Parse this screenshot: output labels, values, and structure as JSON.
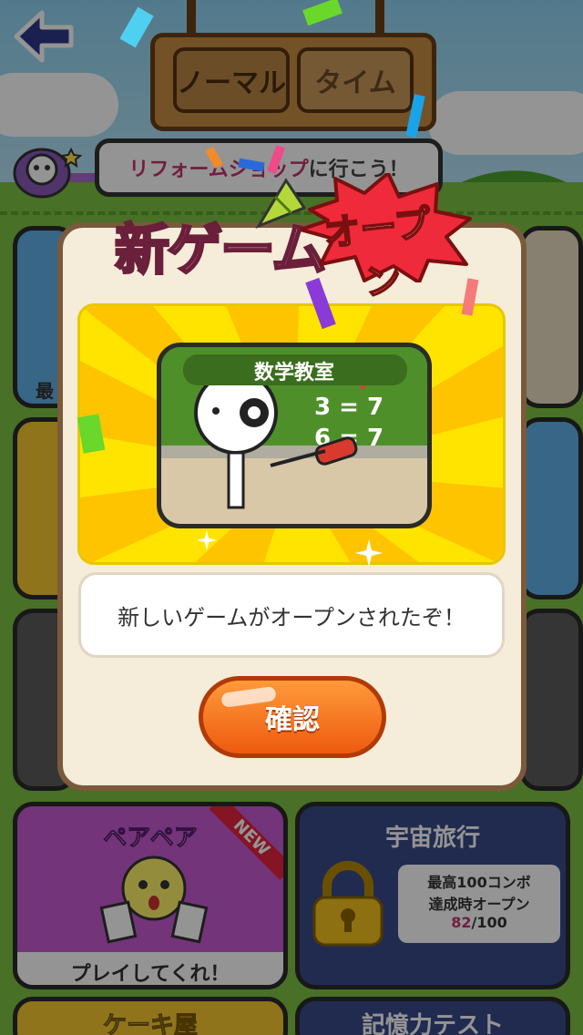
{
  "header": {
    "tabs": [
      {
        "label": "ノーマル",
        "selected": true
      },
      {
        "label": "タイム",
        "selected": false
      }
    ]
  },
  "speech": {
    "highlight": "リフォームショップ",
    "rest": "に行こう！"
  },
  "tiles": {
    "pair": {
      "title": "ペアペア",
      "badge": "NEW",
      "footer": "プレイしてくれ！"
    },
    "space": {
      "title": "宇宙旅行",
      "requirement_line1": "最高100コンボ",
      "requirement_line2": "達成時オープン",
      "progress_current": "82",
      "progress_total": "/100"
    },
    "cake": {
      "title": "ケーキ屋"
    },
    "memory": {
      "title": "記憶力テスト"
    },
    "partial_label": "最"
  },
  "modal": {
    "headline": "新ゲーム",
    "burst": "オープン",
    "game_title": "数学教室",
    "message": "新しいゲームがオープンされたぞ！",
    "confirm_label": "確認"
  },
  "colors": {
    "confirm": "#ee5a0f",
    "modal_bg": "#f5ecd9",
    "promo_bg": "#ffe400",
    "progress": "#c3356d"
  }
}
